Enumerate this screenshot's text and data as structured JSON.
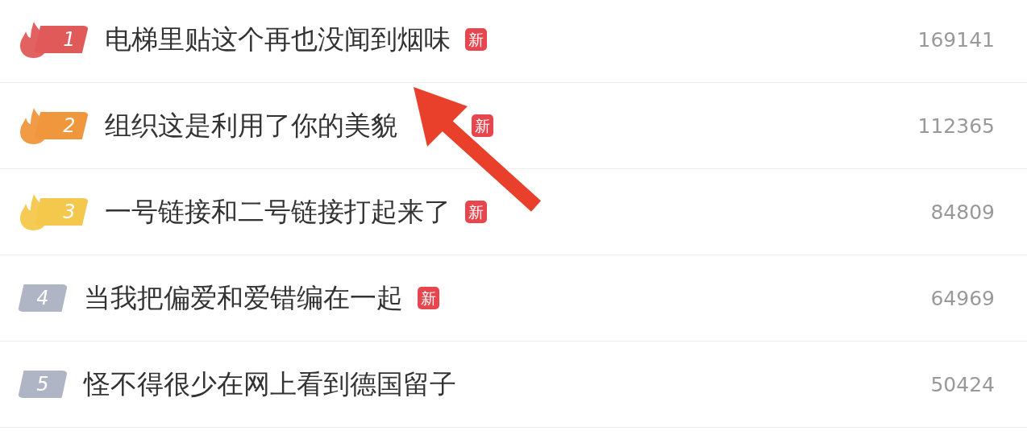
{
  "items": [
    {
      "rank": "1",
      "kind": "hot",
      "color": "#e05a5a",
      "title": "电梯里贴这个再也没闻到烟味",
      "tag": "新",
      "count": "169141"
    },
    {
      "rank": "2",
      "kind": "hot",
      "color": "#f0963c",
      "title": "组织这是利用了你的美貌",
      "tag": "新",
      "count": "112365"
    },
    {
      "rank": "3",
      "kind": "hot",
      "color": "#f4c84c",
      "title": "一号链接和二号链接打起来了",
      "tag": "新",
      "count": "84809"
    },
    {
      "rank": "4",
      "kind": "plain",
      "color": "#b0b5c6",
      "title": "当我把偏爱和爱错编在一起",
      "tag": "新",
      "count": "64969"
    },
    {
      "rank": "5",
      "kind": "plain",
      "color": "#b0b5c6",
      "title": "怪不得很少在网上看到德国留子",
      "count": "50424"
    }
  ]
}
